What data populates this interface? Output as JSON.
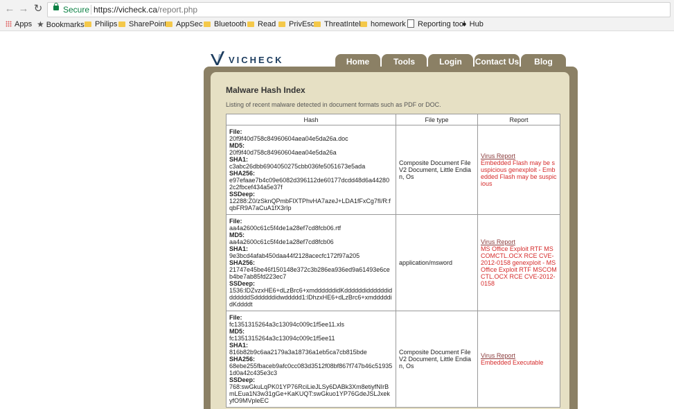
{
  "browser": {
    "secure_label": "Secure",
    "url_base": "https://vicheck.ca",
    "url_path": "/report.php",
    "bookmarks": [
      "Apps",
      "Bookmarks",
      "Philips",
      "SharePoint",
      "AppSec",
      "Bluetooth",
      "Read",
      "PrivEsc",
      "ThreatIntel",
      "homework",
      "Reporting tool",
      "Hub"
    ]
  },
  "site": {
    "logo_text": "VICHECK",
    "nav": [
      "Home",
      "Tools",
      "Login",
      "Contact Us",
      "Blog"
    ],
    "title": "Malware Hash Index",
    "intro": "Listing of recent malware detected in document formats such as PDF or DOC."
  },
  "table": {
    "headers": [
      "Hash",
      "File type",
      "Report"
    ],
    "labels": {
      "file": "File:",
      "md5": "MD5:",
      "sha1": "SHA1:",
      "sha256": "SHA256:",
      "ssdeep": "SSDeep:"
    },
    "rows": [
      {
        "file": "20f9f40d758c84960604aea04e5da26a.doc",
        "md5": "20f9f40d758c84960604aea04e5da26a",
        "sha1": "c3abc26dbb6904050275cbb036fe5051673e5ada",
        "sha256": "e97efaae7b4c09e6082d396112de60177dcdd48d6a442802c2fbcef434a5e37f",
        "ssdeep": "12288:Z0/zSknQPmbFlXTPhvHA7azeJ+LDA1fFxCg7fI/R:fqbFR9A7aCuA1fX3rIp",
        "filetype": "Composite Document File V2 Document, Little Endian, Os",
        "report_link": "Virus Report",
        "report_text": "Embedded Flash may be suspicious genexploit - Embedded Flash may be suspicious"
      },
      {
        "file": "aa4a2600c61c5f4de1a28ef7cd8fcb06.rtf",
        "md5": "aa4a2600c61c5f4de1a28ef7cd8fcb06",
        "sha1": "9e3bcd4afab450daa44f2128acecfc172f97a205",
        "sha256": "21747e45be46f150148e372c3b286ea936ed9a61493e6ceb4be7ab85fd223ec7",
        "ssdeep": "1536:lDZvzxHE6+dLzBrc6+xmddddddidKddddddiddddddidddddddSddddddidwddddd1:lDhzxHE6+dLzBrc6+xmdddddidKddddt",
        "filetype": "application/msword",
        "report_link": "Virus Report",
        "report_text": "MS Office Exploit RTF MSCOMCTL.OCX RCE CVE-2012-0158 genexploit - MS Office Exploit RTF MSCOMCTL.OCX RCE CVE-2012-0158"
      },
      {
        "file": "fc1351315264a3c13094c009c1f5ee11.xls",
        "md5": "fc1351315264a3c13094c009c1f5ee11",
        "sha1": "816b82b9c6aa2179a3a18736a1eb5ca7cb815bde",
        "sha256": "68ebe255fbaceb9afc0cc083d3512f08bf867f747b46c519351d0a42c435e3c3",
        "ssdeep": "768:swGkuLqPK01YP76RciLieJLSy6DABk3Xm8etiyfNIrBmLEua1N3w31gGe+KaKUQT:swGkuo1YP76GdeJSLJxekyfO9MVpleEC",
        "filetype": "Composite Document File V2 Document, Little Endian, Os",
        "report_link": "Virus Report",
        "report_text": "Embedded Executable"
      }
    ]
  }
}
